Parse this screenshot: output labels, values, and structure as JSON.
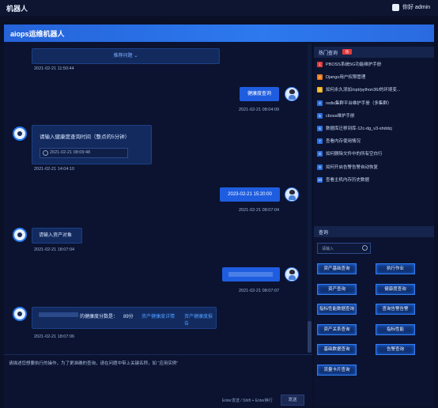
{
  "app": {
    "title": "机器人",
    "user_label": "你好 admin"
  },
  "panel": {
    "title": "aiops运维机器人"
  },
  "chat": {
    "messages": [
      {
        "role": "bot",
        "bubble": "推荐问题",
        "timestamp": "2021-02-21 11:50:44"
      },
      {
        "role": "user",
        "bubble": "健康度查询",
        "timestamp": "2021-02-21 08:04:09"
      },
      {
        "role": "bot",
        "prompt": "请输入健康度查询时间（整点的5分钟）",
        "input_value": "2021-02-21 08:09:48",
        "timestamp": "2021-02-21 14:04:10"
      },
      {
        "role": "user",
        "bubble": "2023-02-21 15:20:00",
        "timestamp": "2021-02-21 08:07:04"
      },
      {
        "role": "bot",
        "bubble": "请输入资产对象",
        "timestamp": "2021-02-21 18:07:04"
      },
      {
        "role": "user",
        "bubble": "",
        "timestamp": "2021-02-21 08:07:07"
      },
      {
        "role": "bot",
        "text_prefix": "的健康度分数是：",
        "score": "89分",
        "link1": "资产健康度详情",
        "link2": "资产健康度报告",
        "timestamp": "2021-02-21 18:07:06"
      }
    ]
  },
  "input": {
    "placeholder": "请描述您想要执行的操作，为了更准确的查询，请在问题中带上关键名称，如 “应用实例”",
    "hint": "Enter发送 / Shift + Enter换行",
    "send_label": "发送"
  },
  "faq": {
    "title": "热门查询",
    "badge": "热",
    "items": [
      {
        "n": "1",
        "label": "PBOSS系统5G功能维护手册",
        "color": "#e23a3a"
      },
      {
        "n": "2",
        "label": "Django用户权限管理",
        "color": "#f07a1d"
      },
      {
        "n": "3",
        "label": "如何永久添加/opt/python36/的环境变...",
        "color": "#f0b41d"
      },
      {
        "n": "4",
        "label": "redis集群平台维护手册（多集群）",
        "color": "#2b6fe0"
      },
      {
        "n": "5",
        "label": "cboss维护手册",
        "color": "#2b6fe0"
      },
      {
        "n": "6",
        "label": "数据库迁移到库-12c-dg_v3-shddzj",
        "color": "#2b6fe0"
      },
      {
        "n": "7",
        "label": "查看内存使用情况",
        "color": "#2b6fe0"
      },
      {
        "n": "8",
        "label": "如何删除文件中的所有空白行",
        "color": "#2b6fe0"
      },
      {
        "n": "9",
        "label": "如何开启告警告警自动恢复",
        "color": "#2b6fe0"
      },
      {
        "n": "10",
        "label": "查看主机内存历史数据",
        "color": "#2b6fe0"
      }
    ]
  },
  "query": {
    "title": "查询",
    "search_placeholder": "请输入",
    "buttons": [
      "资产基础查询",
      "执行作业",
      "资产查询",
      "健康度查询",
      "指标性能数据查询",
      "查询告警告警",
      "资产关系查询",
      "指标性能",
      "基础数据查询",
      "告警查询",
      "流量卡片查询"
    ]
  }
}
